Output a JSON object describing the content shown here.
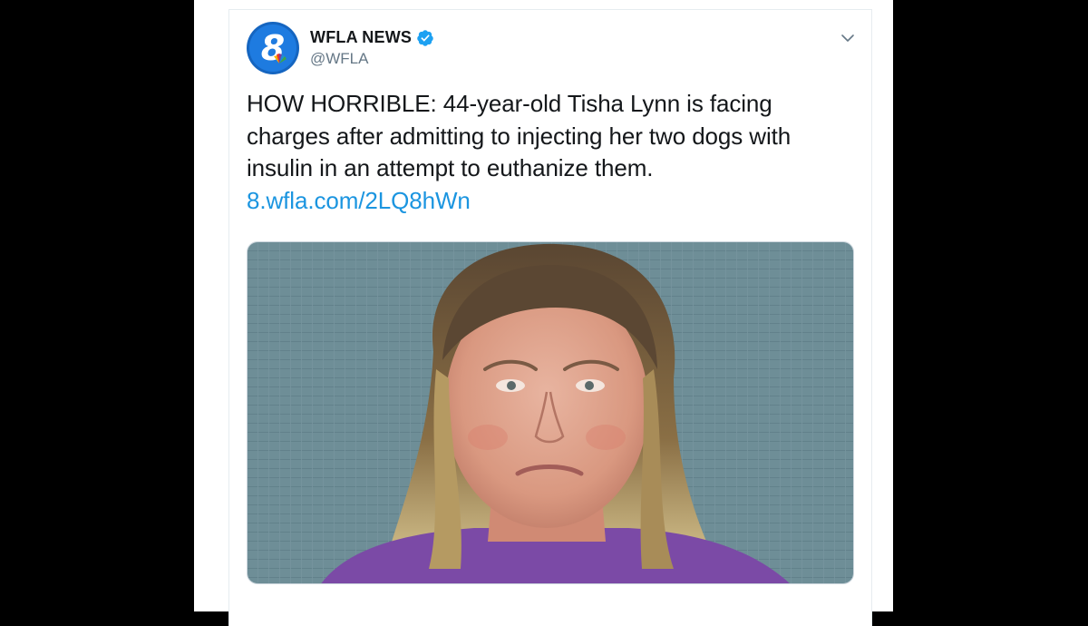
{
  "tweet": {
    "account": {
      "display_name": "WFLA NEWS",
      "handle": "@WFLA",
      "verified": true,
      "avatar_icon": "wfla-8-nbc-logo",
      "avatar_digit": "8"
    },
    "text": "HOW HORRIBLE: 44-year-old Tisha Lynn is facing charges after admitting to injecting her two dogs with insulin in an attempt to euthanize them.",
    "link": "8.wfla.com/2LQ8hWn",
    "media": {
      "type": "photo"
    }
  },
  "colors": {
    "background": "#000000",
    "card": "#ffffff",
    "link": "#1b95e0",
    "verified": "#1da1f2",
    "handle": "#657786",
    "text": "#14171a",
    "avatar": "#1565c0"
  },
  "icons": {
    "caret": "chevron-down-icon",
    "verified": "verified-badge-icon"
  }
}
